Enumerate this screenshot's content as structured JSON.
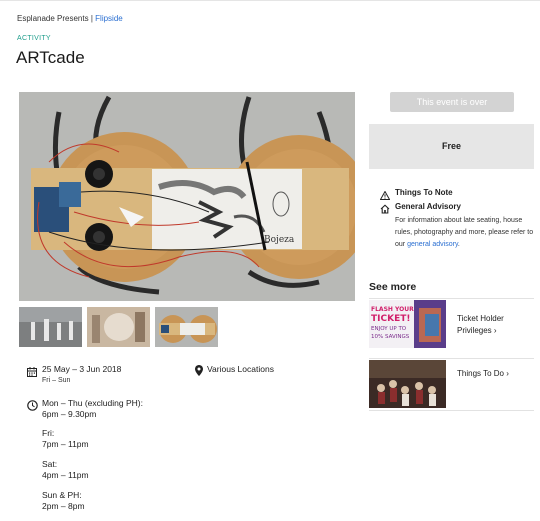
{
  "breadcrumb": {
    "presenter": "Esplanade Presents",
    "separator": "|",
    "series": "Flipside"
  },
  "category": "ACTIVITY",
  "title": "ARTcade",
  "schedule": {
    "dates": "25 May – 3 Jun 2018",
    "days": "Fri – Sun",
    "location": "Various Locations",
    "times": [
      {
        "label": "Mon – Thu (excluding PH):",
        "value": "6pm – 9.30pm"
      },
      {
        "label": "Fri:",
        "value": "7pm – 11pm"
      },
      {
        "label": "Sat:",
        "value": "4pm – 11pm"
      },
      {
        "label": "Sun & PH:",
        "value": "2pm – 8pm"
      }
    ]
  },
  "sidebar": {
    "event_over_label": "This event is over",
    "price": "Free",
    "things_to_note": "Things To Note",
    "general_advisory": "General Advisory",
    "advisory_text": "For information about late seating, house rules, photography and more, please refer to our",
    "advisory_link": "general advisory",
    "advisory_end": ".",
    "see_more": "See more",
    "links": [
      {
        "label": "Ticket Holder Privileges",
        "chevron": "›"
      },
      {
        "label": "Things To Do",
        "chevron": "›"
      }
    ],
    "promo": {
      "line1": "FLASH YOUR",
      "line2": "TICKET!",
      "line3": "ENJOY UP TO",
      "line4": "10% SAVINGS"
    }
  },
  "hero_signature": "Bojeza",
  "icons": [
    "calendar-icon",
    "location-pin-icon",
    "clock-icon",
    "warning-icon",
    "home-icon",
    "chevron-right-icon"
  ],
  "colors": {
    "link": "#2b6fd1",
    "category": "#1f9e8c",
    "button_disabled": "#d3d3d3",
    "price_bg": "#e6e6e6"
  }
}
